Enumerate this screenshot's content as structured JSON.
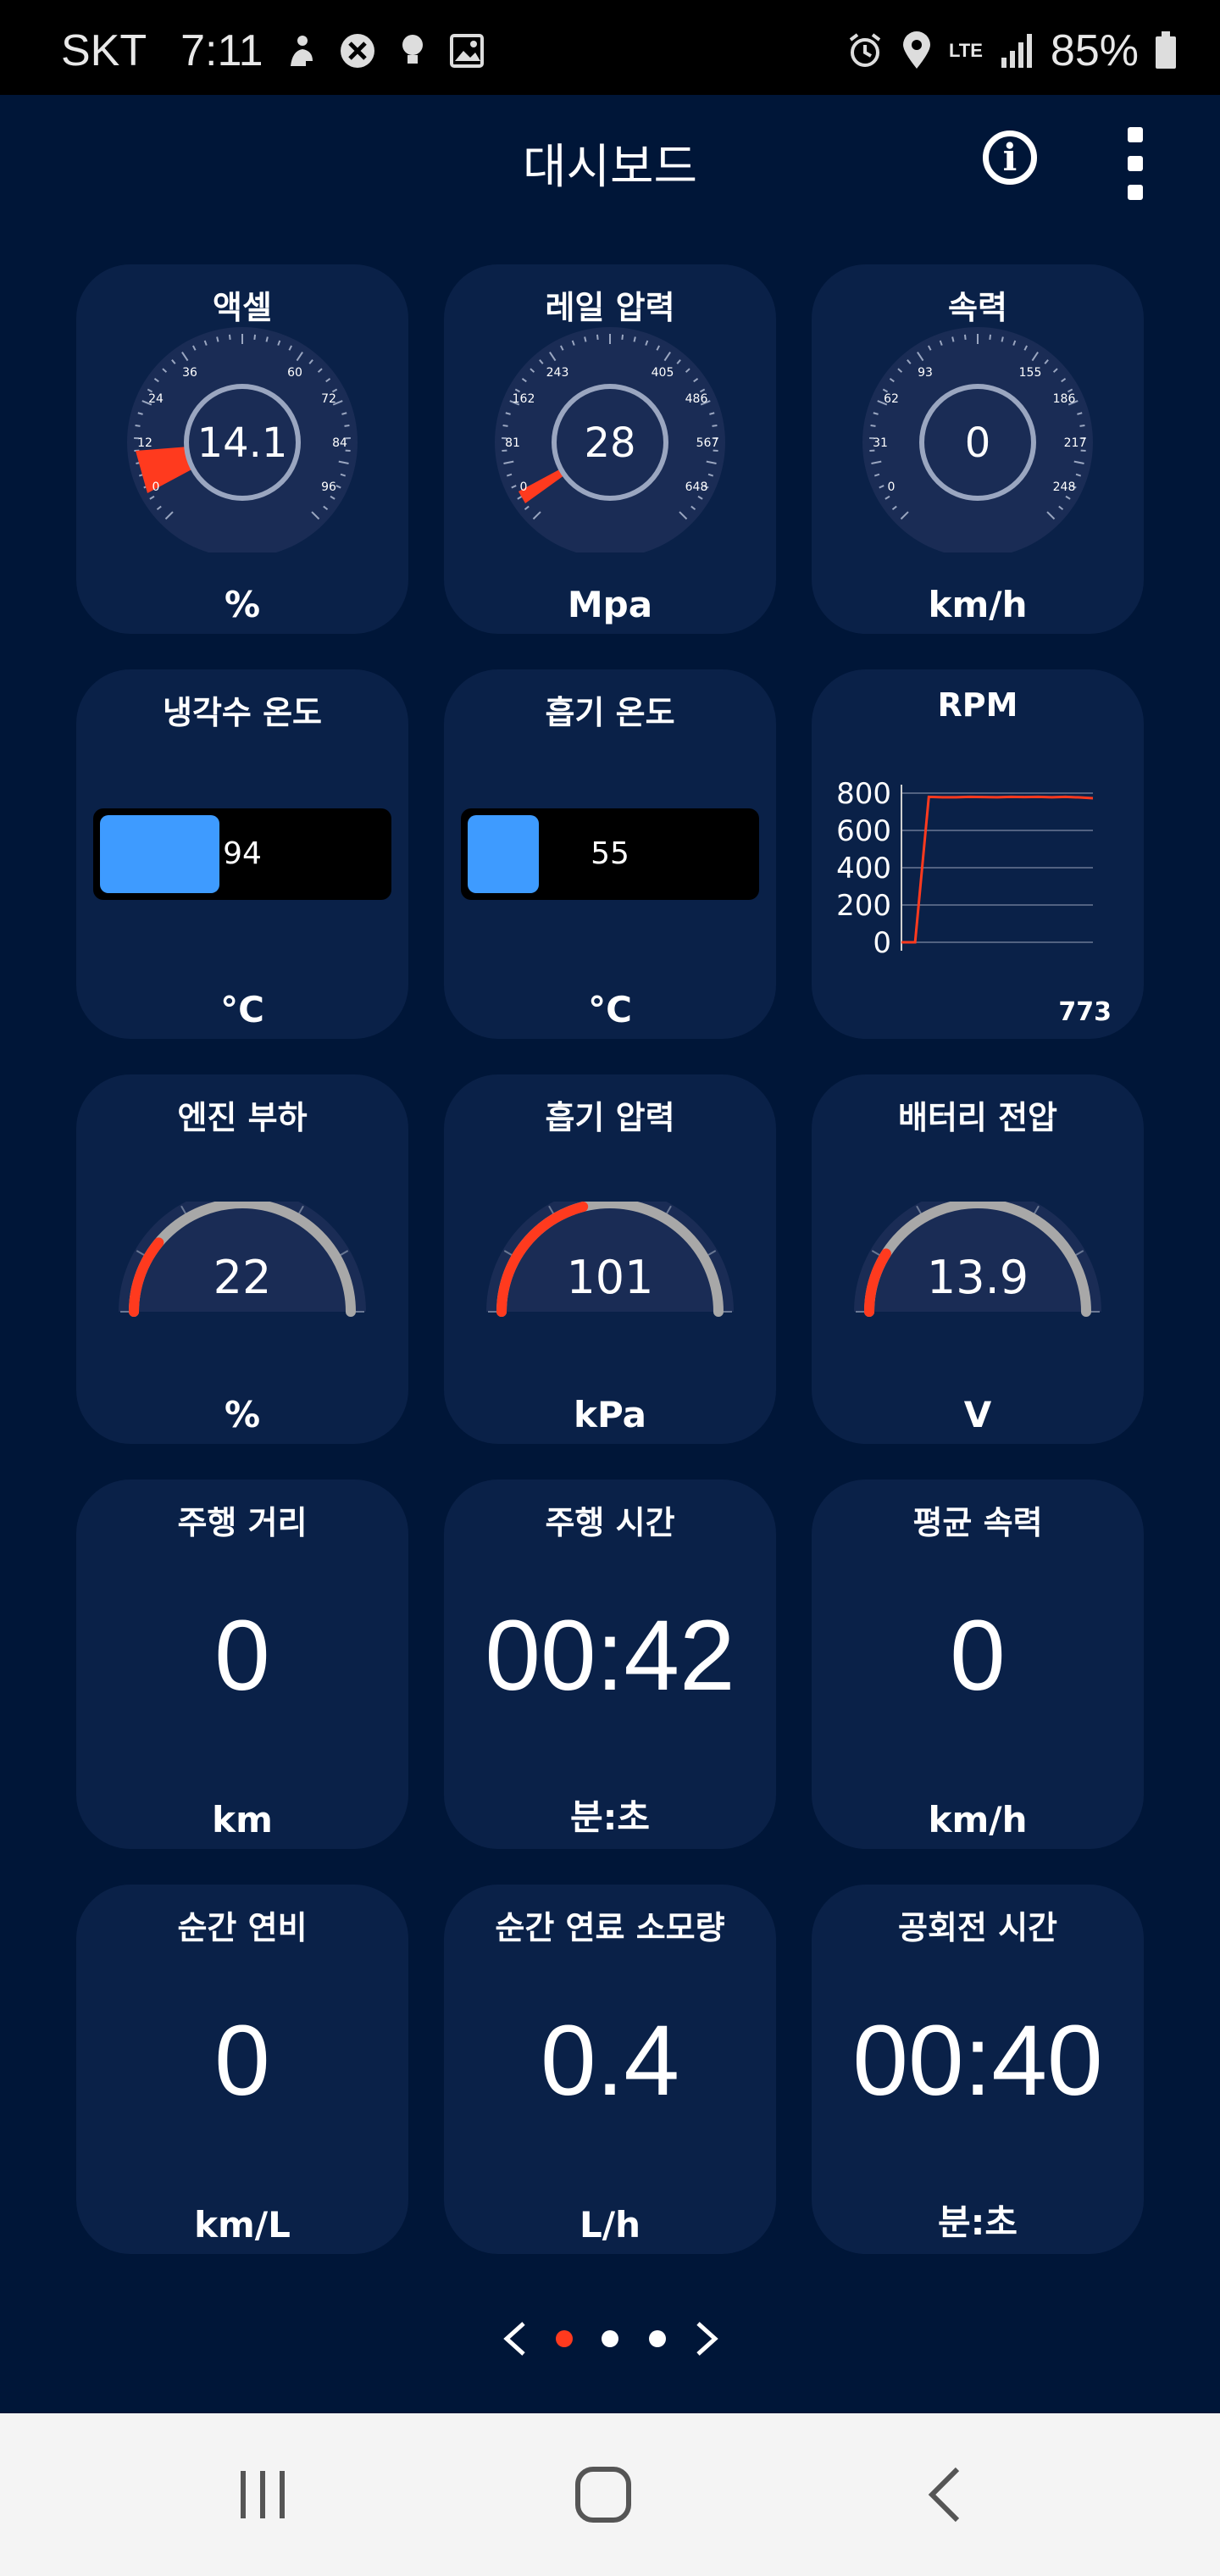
{
  "status": {
    "carrier": "SKT",
    "time": "7:11",
    "battery": "85%",
    "network": "LTE",
    "left_icons": [
      "person-icon",
      "blocked-icon",
      "bulb-icon",
      "image-icon"
    ],
    "right_icons": [
      "alarm-icon",
      "location-icon",
      "lte-icon",
      "signal-icon",
      "battery-icon"
    ]
  },
  "appbar": {
    "title": "대시보드",
    "info_icon": "info-icon",
    "more_icon": "more-vert-icon"
  },
  "tiles": {
    "accel": {
      "title": "액셀",
      "value": "14.1",
      "unit": "%",
      "ticks": [
        "0",
        "12",
        "24",
        "36",
        "60",
        "72",
        "84",
        "96"
      ]
    },
    "rail": {
      "title": "레일 압력",
      "value": "28",
      "unit": "Mpa",
      "ticks": [
        "0",
        "81",
        "162",
        "243",
        "405",
        "486",
        "567",
        "648"
      ]
    },
    "speed": {
      "title": "속력",
      "value": "0",
      "unit": "km/h",
      "ticks": [
        "0",
        "31",
        "62",
        "93",
        "155",
        "186",
        "217",
        "248"
      ]
    },
    "coolant": {
      "title": "냉각수 온도",
      "value": "94",
      "unit": "°C",
      "fill": 0.42
    },
    "intake_temp": {
      "title": "흡기 온도",
      "value": "55",
      "unit": "°C",
      "fill": 0.25
    },
    "rpm": {
      "title": "RPM",
      "value": "773",
      "yticks": [
        "800",
        "600",
        "400",
        "200",
        "0"
      ]
    },
    "engine_load": {
      "title": "엔진 부하",
      "value": "22",
      "unit": "%",
      "fill": 0.22
    },
    "intake_pressure": {
      "title": "흡기 압력",
      "value": "101",
      "unit": "kPa",
      "fill": 0.42
    },
    "battery_voltage": {
      "title": "배터리 전압",
      "value": "13.9",
      "unit": "V",
      "fill": 0.18
    },
    "trip_distance": {
      "title": "주행 거리",
      "value": "0",
      "unit": "km"
    },
    "trip_time": {
      "title": "주행 시간",
      "value": "00:42",
      "unit": "분:초"
    },
    "avg_speed": {
      "title": "평균 속력",
      "value": "0",
      "unit": "km/h"
    },
    "inst_economy": {
      "title": "순간 연비",
      "value": "0",
      "unit": "km/L"
    },
    "inst_fuel": {
      "title": "순간 연료 소모량",
      "value": "0.4",
      "unit": "L/h"
    },
    "idle_time": {
      "title": "공회전 시간",
      "value": "00:40",
      "unit": "분:초"
    }
  },
  "chart_data": {
    "type": "line",
    "title": "RPM",
    "x": [
      0,
      1,
      2,
      3,
      4,
      5,
      6,
      7,
      8,
      9,
      10,
      11,
      12,
      13,
      14
    ],
    "series": [
      {
        "values": [
          0,
          0,
          780,
          778,
          778,
          780,
          779,
          778,
          780,
          779,
          780,
          778,
          780,
          777,
          773
        ]
      }
    ],
    "ylim": [
      0,
      800
    ],
    "yticks": [
      0,
      200,
      400,
      600,
      800
    ],
    "grid": true
  },
  "pager": {
    "pages": 3,
    "current": 0,
    "prev_icon": "chevron-left-icon",
    "next_icon": "chevron-right-icon"
  },
  "navbar": {
    "recent_icon": "recent-apps-icon",
    "home_icon": "home-icon",
    "back_icon": "back-icon"
  }
}
